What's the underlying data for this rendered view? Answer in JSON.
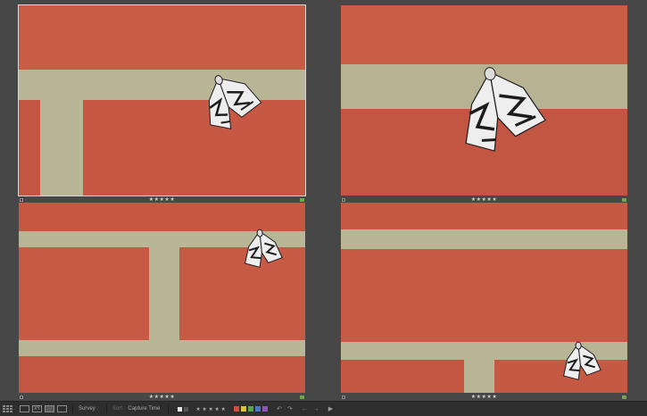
{
  "survey_cells": [
    {
      "selected": true,
      "rating": "★★★★★"
    },
    {
      "selected": false,
      "rating": "★★★★★"
    },
    {
      "selected": false,
      "rating": "★★★★★"
    },
    {
      "selected": false,
      "rating": "★★★★★"
    }
  ],
  "toolbar": {
    "grid_icon": "grid-view-icon",
    "loupe_icon": "loupe-view-icon",
    "compare_label": "XY",
    "survey_icon": "survey-view-icon",
    "people_icon": "people-view-icon",
    "survey_label": "Survey :",
    "sort_label": "Sort :",
    "sort_value": "Capture Time",
    "rating_filter": "★ ★ ★ ★ ★",
    "color_labels": [
      "#d84a3a",
      "#e0c23a",
      "#5aa54a",
      "#4a77c8",
      "#8a56b8"
    ],
    "rotate_left": "↶",
    "rotate_right": "↷",
    "prev": "←",
    "next": "→",
    "play": "▶"
  },
  "colors": {
    "brick": "#c45642",
    "mortar": "#b8b49a",
    "moth_light": "#f2f2f2",
    "moth_dark": "#1c1c1c"
  }
}
